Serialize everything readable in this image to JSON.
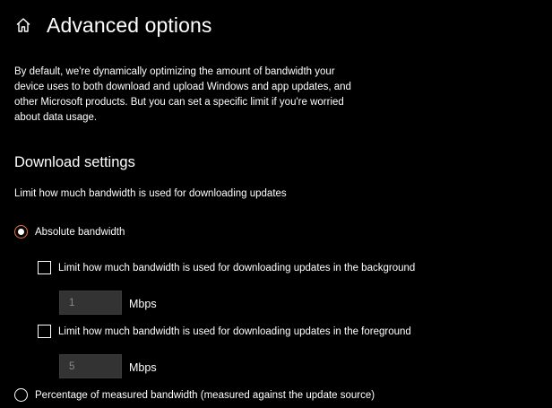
{
  "header": {
    "title": "Advanced options",
    "icon": "home-icon"
  },
  "description": "By default, we're dynamically optimizing the amount of bandwidth your device uses to both download and upload Windows and app updates, and other Microsoft products. But you can set a specific limit if you're worried about data usage.",
  "download_settings": {
    "section_title": "Download settings",
    "subtitle": "Limit how much bandwidth is used for downloading updates",
    "absolute_option": {
      "label": "Absolute bandwidth",
      "selected": true
    },
    "background_limit": {
      "label": "Limit how much bandwidth is used for downloading updates in the background",
      "checked": false,
      "value": "1",
      "unit": "Mbps"
    },
    "foreground_limit": {
      "label": "Limit how much bandwidth is used for downloading updates in the foreground",
      "checked": false,
      "value": "5",
      "unit": "Mbps"
    },
    "percentage_option": {
      "label": "Percentage of measured bandwidth (measured against the update source)",
      "selected": false
    }
  },
  "colors": {
    "background": "#000000",
    "text": "#ffffff",
    "accent": "#e8743b",
    "input_bg": "#333333",
    "input_text": "#8a8a8a"
  }
}
